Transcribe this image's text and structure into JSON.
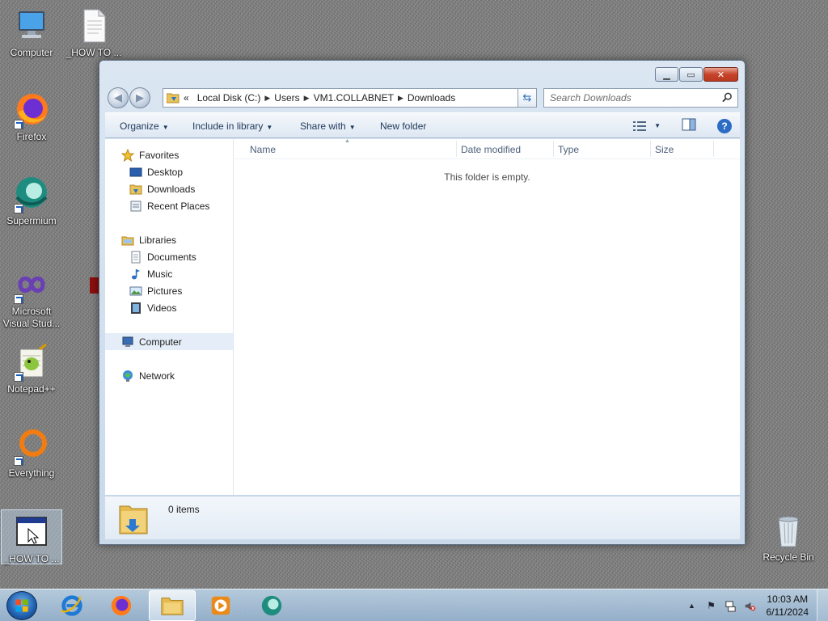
{
  "desktop": {
    "icons": [
      {
        "label": "Computer"
      },
      {
        "label": "_HOW TO ..."
      },
      {
        "label": "Firefox"
      },
      {
        "label": "Supermium"
      },
      {
        "label": "Microsoft Visual Stud..."
      },
      {
        "label": "Notepad++"
      },
      {
        "label": "Everything"
      },
      {
        "label": "_HOW TO ..."
      },
      {
        "label": "Recycle Bin"
      }
    ]
  },
  "window": {
    "address": {
      "overflow": "«",
      "crumbs": [
        "Local Disk (C:)",
        "Users",
        "VM1.COLLABNET",
        "Downloads"
      ]
    },
    "search": {
      "placeholder": "Search Downloads"
    },
    "toolbar": {
      "organize": "Organize",
      "include_in_library": "Include in library",
      "share_with": "Share with",
      "new_folder": "New folder"
    },
    "navpane": {
      "favorites": "Favorites",
      "desktop": "Desktop",
      "downloads": "Downloads",
      "recent_places": "Recent Places",
      "libraries": "Libraries",
      "documents": "Documents",
      "music": "Music",
      "pictures": "Pictures",
      "videos": "Videos",
      "computer": "Computer",
      "network": "Network"
    },
    "columns": {
      "name": "Name",
      "date_modified": "Date modified",
      "type": "Type",
      "size": "Size"
    },
    "empty_message": "This folder is empty.",
    "details": {
      "item_count": "0 items"
    }
  },
  "taskbar": {
    "clock": {
      "time": "10:03 AM",
      "date": "6/11/2024"
    }
  }
}
